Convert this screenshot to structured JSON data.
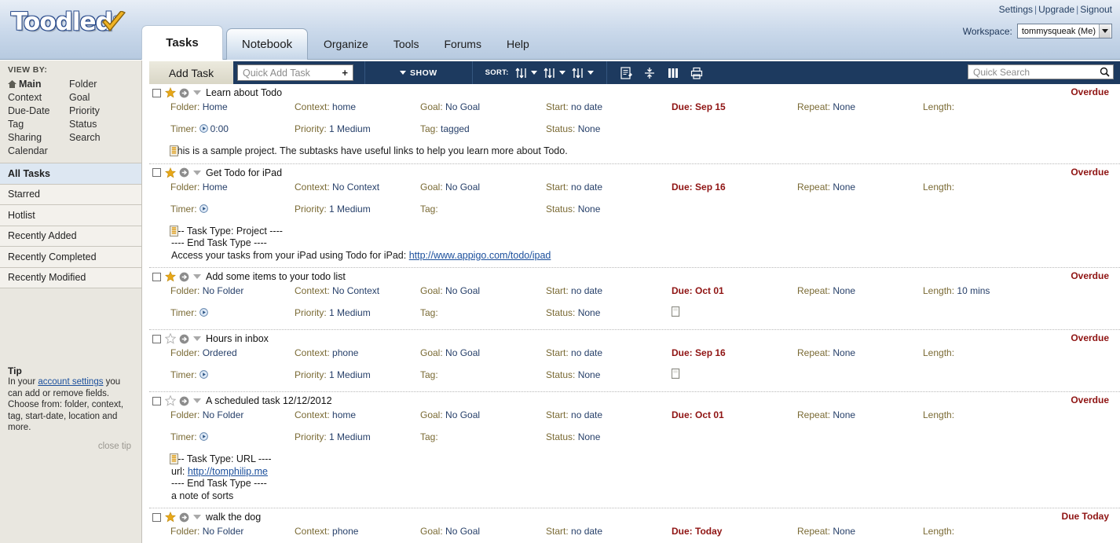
{
  "header": {
    "logo_text": "Toodled",
    "logo_reg": "®",
    "logo_check_icon": "check-mark-icon",
    "account_links": [
      {
        "label": "Settings"
      },
      {
        "label": "Upgrade"
      },
      {
        "label": "Signout"
      }
    ],
    "link_separator": "|",
    "workspace_label": "Workspace:",
    "workspace_value": "tommysqueak (Me)"
  },
  "tabs": [
    {
      "label": "Tasks",
      "active": true,
      "type": "tab"
    },
    {
      "label": "Notebook",
      "active": false,
      "type": "tab"
    },
    {
      "label": "Organize",
      "active": false,
      "type": "link"
    },
    {
      "label": "Tools",
      "active": false,
      "type": "link"
    },
    {
      "label": "Forums",
      "active": false,
      "type": "link"
    },
    {
      "label": "Help",
      "active": false,
      "type": "link"
    }
  ],
  "sidebar": {
    "viewby_header": "VIEW BY:",
    "viewby_col1": [
      {
        "label": "Main",
        "bold": true,
        "icon": "home-icon"
      },
      {
        "label": "Context"
      },
      {
        "label": "Due-Date"
      },
      {
        "label": "Tag"
      },
      {
        "label": "Sharing"
      },
      {
        "label": "Calendar"
      }
    ],
    "viewby_col2": [
      {
        "label": "Folder"
      },
      {
        "label": "Goal"
      },
      {
        "label": "Priority"
      },
      {
        "label": "Status"
      },
      {
        "label": "Search"
      }
    ],
    "lists": [
      {
        "label": "All Tasks",
        "active": true
      },
      {
        "label": "Starred",
        "active": false
      },
      {
        "label": "Hotlist",
        "active": false
      },
      {
        "label": "Recently Added",
        "active": false
      },
      {
        "label": "Recently Completed",
        "active": false
      },
      {
        "label": "Recently Modified",
        "active": false
      }
    ],
    "tip": {
      "title": "Tip",
      "text_before": "In your ",
      "link": "account settings",
      "text_after": " you can add or remove fields. Choose from: folder, context, tag, start-date, location and more.",
      "close_label": "close tip"
    }
  },
  "toolbar": {
    "add_task_label": "Add Task",
    "quick_add_placeholder": "Quick Add Task",
    "quick_add_plus": "+",
    "show_label": "SHOW",
    "sort_label": "SORT:",
    "sort_buttons": [
      "sort-primary-icon",
      "sort-secondary-icon",
      "sort-tertiary-icon"
    ],
    "action_icons": [
      "edit-note-icon",
      "collapse-rows-icon",
      "columns-icon",
      "print-icon"
    ],
    "search_placeholder": "Quick Search",
    "search_icon": "search-icon"
  },
  "field_labels": {
    "folder": "Folder:",
    "context": "Context:",
    "goal": "Goal:",
    "start": "Start:",
    "due": "Due:",
    "repeat": "Repeat:",
    "length": "Length:",
    "timer": "Timer:",
    "priority": "Priority:",
    "tag": "Tag:",
    "status": "Status:"
  },
  "tasks": [
    {
      "title": "Learn about Todo",
      "starred": true,
      "status_badge": "Overdue",
      "folder": "Home",
      "context": "home",
      "goal": "No Goal",
      "start": "no date",
      "due": "Sep 15",
      "repeat": "None",
      "length": "",
      "timer": "0:00",
      "priority": "1 Medium",
      "tag": "tagged",
      "status": "None",
      "note_lines": [
        {
          "text": "This is a sample project. The subtasks have useful links to help you learn more about Todo."
        }
      ],
      "empty_note_icon": false
    },
    {
      "title": "Get Todo for iPad",
      "starred": true,
      "status_badge": "Overdue",
      "folder": "Home",
      "context": "No Context",
      "goal": "No Goal",
      "start": "no date",
      "due": "Sep 16",
      "repeat": "None",
      "length": "",
      "timer": "",
      "priority": "1 Medium",
      "tag": "",
      "status": "None",
      "note_lines": [
        {
          "text": "---- Task Type: Project ----"
        },
        {
          "text": "---- End Task Type ----"
        },
        {
          "text": "Access your tasks from your iPad using Todo for iPad: ",
          "link": "http://www.appigo.com/todo/ipad"
        }
      ],
      "empty_note_icon": false
    },
    {
      "title": "Add some items to your todo list",
      "starred": true,
      "status_badge": "Overdue",
      "folder": "No Folder",
      "context": "No Context",
      "goal": "No Goal",
      "start": "no date",
      "due": "Oct 01",
      "repeat": "None",
      "length": "10 mins",
      "timer": "",
      "priority": "1 Medium",
      "tag": "",
      "status": "None",
      "note_lines": [],
      "empty_note_icon": true
    },
    {
      "title": "Hours in inbox",
      "starred": false,
      "status_badge": "Overdue",
      "folder": "Ordered",
      "context": "phone",
      "goal": "No Goal",
      "start": "no date",
      "due": "Sep 16",
      "repeat": "None",
      "length": "",
      "timer": "",
      "priority": "1 Medium",
      "tag": "",
      "status": "None",
      "note_lines": [],
      "empty_note_icon": true
    },
    {
      "title": "A scheduled task 12/12/2012",
      "starred": false,
      "status_badge": "Overdue",
      "folder": "No Folder",
      "context": "home",
      "goal": "No Goal",
      "start": "no date",
      "due": "Oct 01",
      "repeat": "None",
      "length": "",
      "timer": "",
      "priority": "1 Medium",
      "tag": "",
      "status": "None",
      "note_lines": [
        {
          "text": "---- Task Type: URL ----"
        },
        {
          "text": "url: ",
          "link": "http://tomphilip.me"
        },
        {
          "text": "---- End Task Type ----"
        },
        {
          "text": "a note of sorts"
        }
      ],
      "empty_note_icon": false
    },
    {
      "title": "walk the dog",
      "starred": true,
      "status_badge": "Due Today",
      "folder": "No Folder",
      "context": "phone",
      "goal": "No Goal",
      "start": "no date",
      "due": "Today",
      "repeat": "None",
      "length": "",
      "timer": "",
      "priority": "",
      "tag": "",
      "status": "",
      "note_lines": [],
      "empty_note_icon": false
    }
  ],
  "colors": {
    "toolbar_bg": "#1d3a5f",
    "overdue": "#8f1413",
    "field_label": "#7a6a34",
    "field_value": "#27406a",
    "sidebar_bg": "#e9e7e0",
    "active_item": "#dde7f2",
    "link": "#1b4f9c",
    "star_gold": "#e8a718"
  }
}
